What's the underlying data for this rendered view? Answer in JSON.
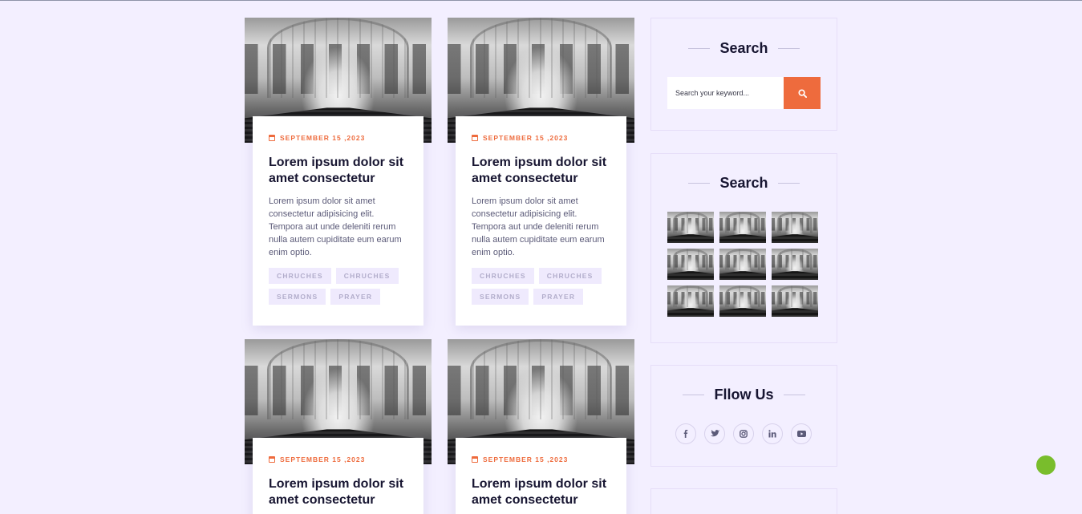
{
  "posts": [
    {
      "date": "SEPTEMBER 15 ,2023",
      "title": "Lorem ipsum dolor sit amet consectetur",
      "excerpt": "Lorem ipsum dolor sit amet consectetur adipisicing elit. Tempora aut unde deleniti rerum nulla autem cupiditate eum earum enim optio.",
      "tags": [
        "CHRUCHES",
        "CHRUCHES",
        "SERMONS",
        "PRAYER"
      ]
    },
    {
      "date": "SEPTEMBER 15 ,2023",
      "title": "Lorem ipsum dolor sit amet consectetur",
      "excerpt": "Lorem ipsum dolor sit amet consectetur adipisicing elit. Tempora aut unde deleniti rerum nulla autem cupiditate eum earum enim optio.",
      "tags": [
        "CHRUCHES",
        "CHRUCHES",
        "SERMONS",
        "PRAYER"
      ]
    },
    {
      "date": "SEPTEMBER 15 ,2023",
      "title": "Lorem ipsum dolor sit amet consectetur"
    },
    {
      "date": "SEPTEMBER 15 ,2023",
      "title": "Lorem ipsum dolor sit amet consectetur"
    }
  ],
  "sidebar": {
    "search_widget": {
      "title": "Search",
      "placeholder": "Search your keyword...",
      "button_icon": "search-icon"
    },
    "gallery_widget": {
      "title": "Search",
      "image_count": 9
    },
    "follow_widget": {
      "title": "Fllow Us",
      "icons": [
        "facebook-icon",
        "twitter-icon",
        "instagram-icon",
        "linkedin-icon",
        "youtube-icon"
      ]
    }
  },
  "colors": {
    "accent": "#ee6b3d",
    "background": "#f3efff",
    "heading": "#171531",
    "float_button": "#79bd2c"
  }
}
